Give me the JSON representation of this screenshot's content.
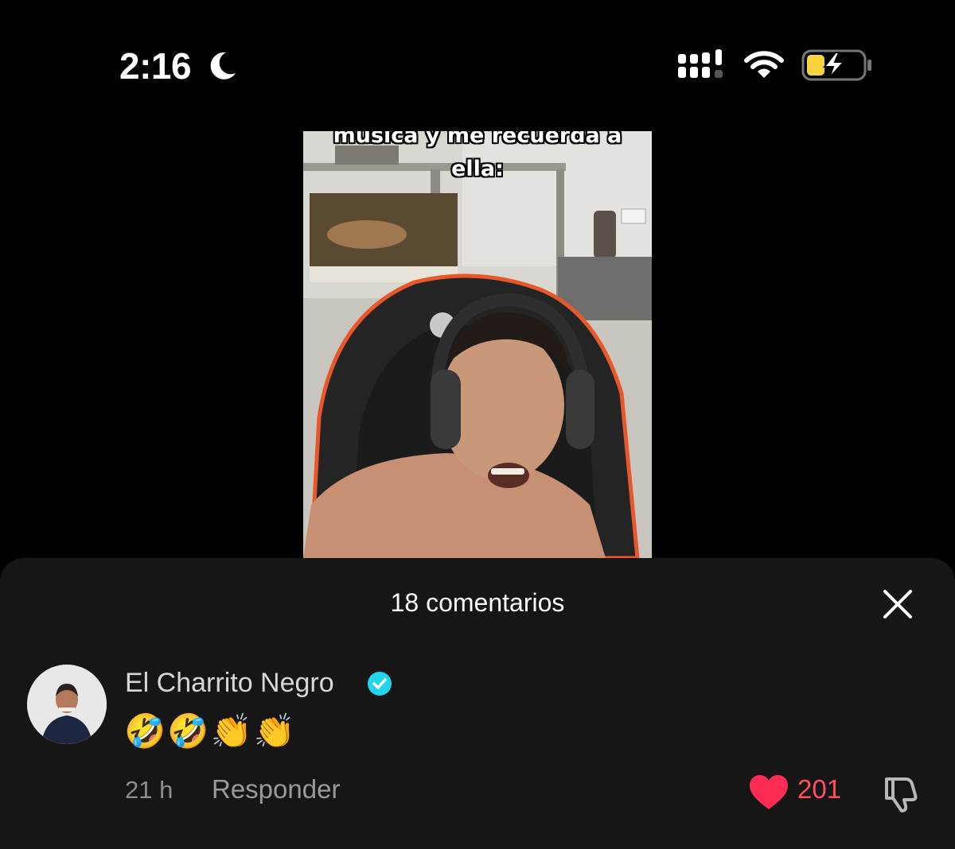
{
  "status_bar": {
    "time": "2:16",
    "focus_icon": "moon-icon",
    "signal_icon": "cellular-signal-icon",
    "wifi_icon": "wifi-icon",
    "battery_icon": "battery-charging-icon",
    "battery_color": "#f5d33c"
  },
  "video": {
    "caption_line_1": "música y me recuerda a",
    "caption_line_2": "ella:"
  },
  "comments": {
    "title": "18 comentarios",
    "close_icon": "close-icon",
    "items": [
      {
        "username": "El Charrito Negro",
        "verified": true,
        "text": "🤣🤣👏👏",
        "time": "21 h",
        "reply_label": "Responder",
        "likes": "201",
        "liked": true,
        "like_color": "#fe2c55"
      }
    ]
  }
}
